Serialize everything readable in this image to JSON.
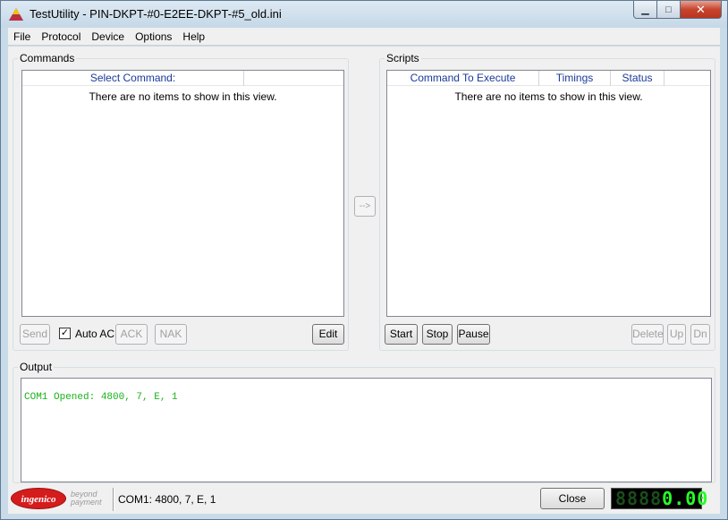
{
  "window": {
    "title": "TestUtility - PIN-DKPT-#0-E2EE-DKPT-#5_old.ini",
    "controls": {
      "minimize": "▁",
      "maximize": "□",
      "close": "✕"
    }
  },
  "menu": {
    "items": [
      "File",
      "Protocol",
      "Device",
      "Options",
      "Help"
    ]
  },
  "commands": {
    "label": "Commands",
    "columns": [
      "Select Command:"
    ],
    "empty_text": "There are no items to show in this view.",
    "send_label": "Send",
    "auto_ack_label": "Auto ACK",
    "auto_ack_checked": true,
    "ack_label": "ACK",
    "nak_label": "NAK",
    "edit_label": "Edit"
  },
  "transfer_button": {
    "label": "-->"
  },
  "scripts": {
    "label": "Scripts",
    "columns": [
      "Command To Execute",
      "Timings",
      "Status"
    ],
    "empty_text": "There are no items to show in this view.",
    "start_label": "Start",
    "stop_label": "Stop",
    "pause_label": "Pause",
    "delete_label": "Delete",
    "up_label": "Up",
    "down_label": "Dn"
  },
  "output": {
    "label": "Output",
    "lines": [
      "COM1 Opened: 4800, 7, E, 1"
    ],
    "text_color": "#19b219"
  },
  "statusbar": {
    "logo_text": "ingenico",
    "tagline": "beyond payment",
    "status_text": "COM1: 4800, 7, E, 1",
    "close_label": "Close",
    "lcd_dim": "8888",
    "lcd_value": "0.00"
  },
  "colors": {
    "header_text": "#1a3a9a",
    "lcd_lit": "#27ff27",
    "logo_red": "#d51c1c"
  }
}
